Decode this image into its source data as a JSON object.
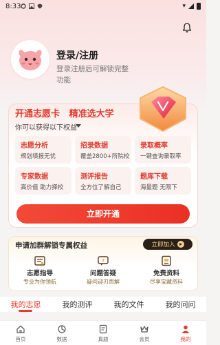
{
  "status_bar": {
    "time": "8:33"
  },
  "profile": {
    "title": "登录/注册",
    "subtitle": "登录注册后可解锁完整功能"
  },
  "vip_card": {
    "title": "开通志愿卡   精准选大学",
    "subtitle": "你可以获得以下权益",
    "benefits": [
      {
        "title": "志愿分析",
        "desc": "规划填报无忧"
      },
      {
        "title": "招录数据",
        "desc": "覆盖2800+所院校"
      },
      {
        "title": "录取概率",
        "desc": "一键查询录取率"
      },
      {
        "title": "专家数据",
        "desc": "高价值 助力择校"
      },
      {
        "title": "测评报告",
        "desc": "全方位了解自己"
      },
      {
        "title": "题库下载",
        "desc": "海量题  无限下"
      }
    ],
    "button": "立即开通"
  },
  "group_card": {
    "title": "申请加群解锁专属权益",
    "join_button": "立即加入",
    "items": [
      {
        "title": "志愿指导",
        "desc": "专业为你领航",
        "icon": "compass-book-icon"
      },
      {
        "title": "问题答疑",
        "desc": "疑问迎刃而解",
        "icon": "qa-icon"
      },
      {
        "title": "免费资料",
        "desc": "尽享宝藏资料",
        "icon": "document-icon"
      }
    ]
  },
  "content_tabs": [
    "我的志愿",
    "我的测评",
    "我的文件",
    "我的问问"
  ],
  "bottom_nav": [
    {
      "label": "首页",
      "icon": "home-icon"
    },
    {
      "label": "数据",
      "icon": "data-icon"
    },
    {
      "label": "真题",
      "icon": "exam-icon"
    },
    {
      "label": "会员",
      "icon": "crown-icon"
    },
    {
      "label": "我的",
      "icon": "profile-icon"
    }
  ],
  "colors": {
    "accent": "#e53a2d",
    "gold": "#f3cf8e"
  }
}
